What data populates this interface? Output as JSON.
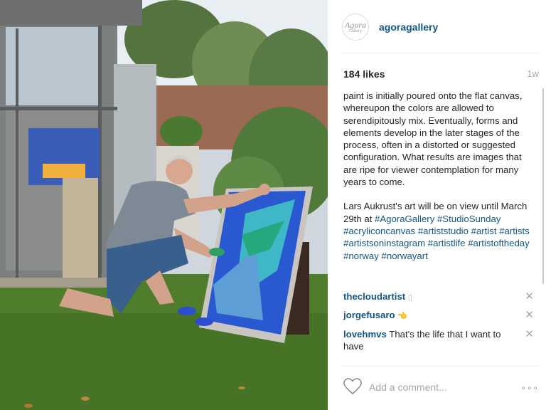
{
  "post": {
    "username": "agoragallery",
    "avatar_text": "Agora",
    "avatar_subtext": "Gallery",
    "likes": "184 likes",
    "time_ago": "1w",
    "caption": {
      "para1": "paint is initially poured onto the flat canvas, whereupon the colors are allowed to serendipitously mix. Eventually, forms and elements develop in the later stages of the process, often in a distorted or suggested configuration. What results are images that are ripe for viewer contemplation for many years to come.",
      "para2_text": "Lars Aukrust's art will be on view until March 29th at ",
      "hashtags": [
        "#AgoraGallery",
        "#StudioSunday",
        "#acryliconcanvas",
        "#artiststudio",
        "#artist",
        "#artists",
        "#artistsoninstagram",
        "#artistlife",
        "#artistoftheday",
        "#norway",
        "#norwayart"
      ]
    },
    "comments": [
      {
        "user": "thecloudartist",
        "text": "",
        "emoji": "▯"
      },
      {
        "user": "jorgefusaro",
        "text": "",
        "emoji": "👈"
      },
      {
        "user": "lovehmvs",
        "text": "That's the life that I want to have",
        "emoji": ""
      }
    ],
    "add_comment_placeholder": "Add a comment...",
    "more_options": "∘∘∘"
  },
  "icons": {
    "heart": "heart-icon",
    "close": "close-icon",
    "more": "more-options-icon"
  },
  "colors": {
    "link": "#125688",
    "muted": "#a5a7aa",
    "text": "#262626"
  }
}
